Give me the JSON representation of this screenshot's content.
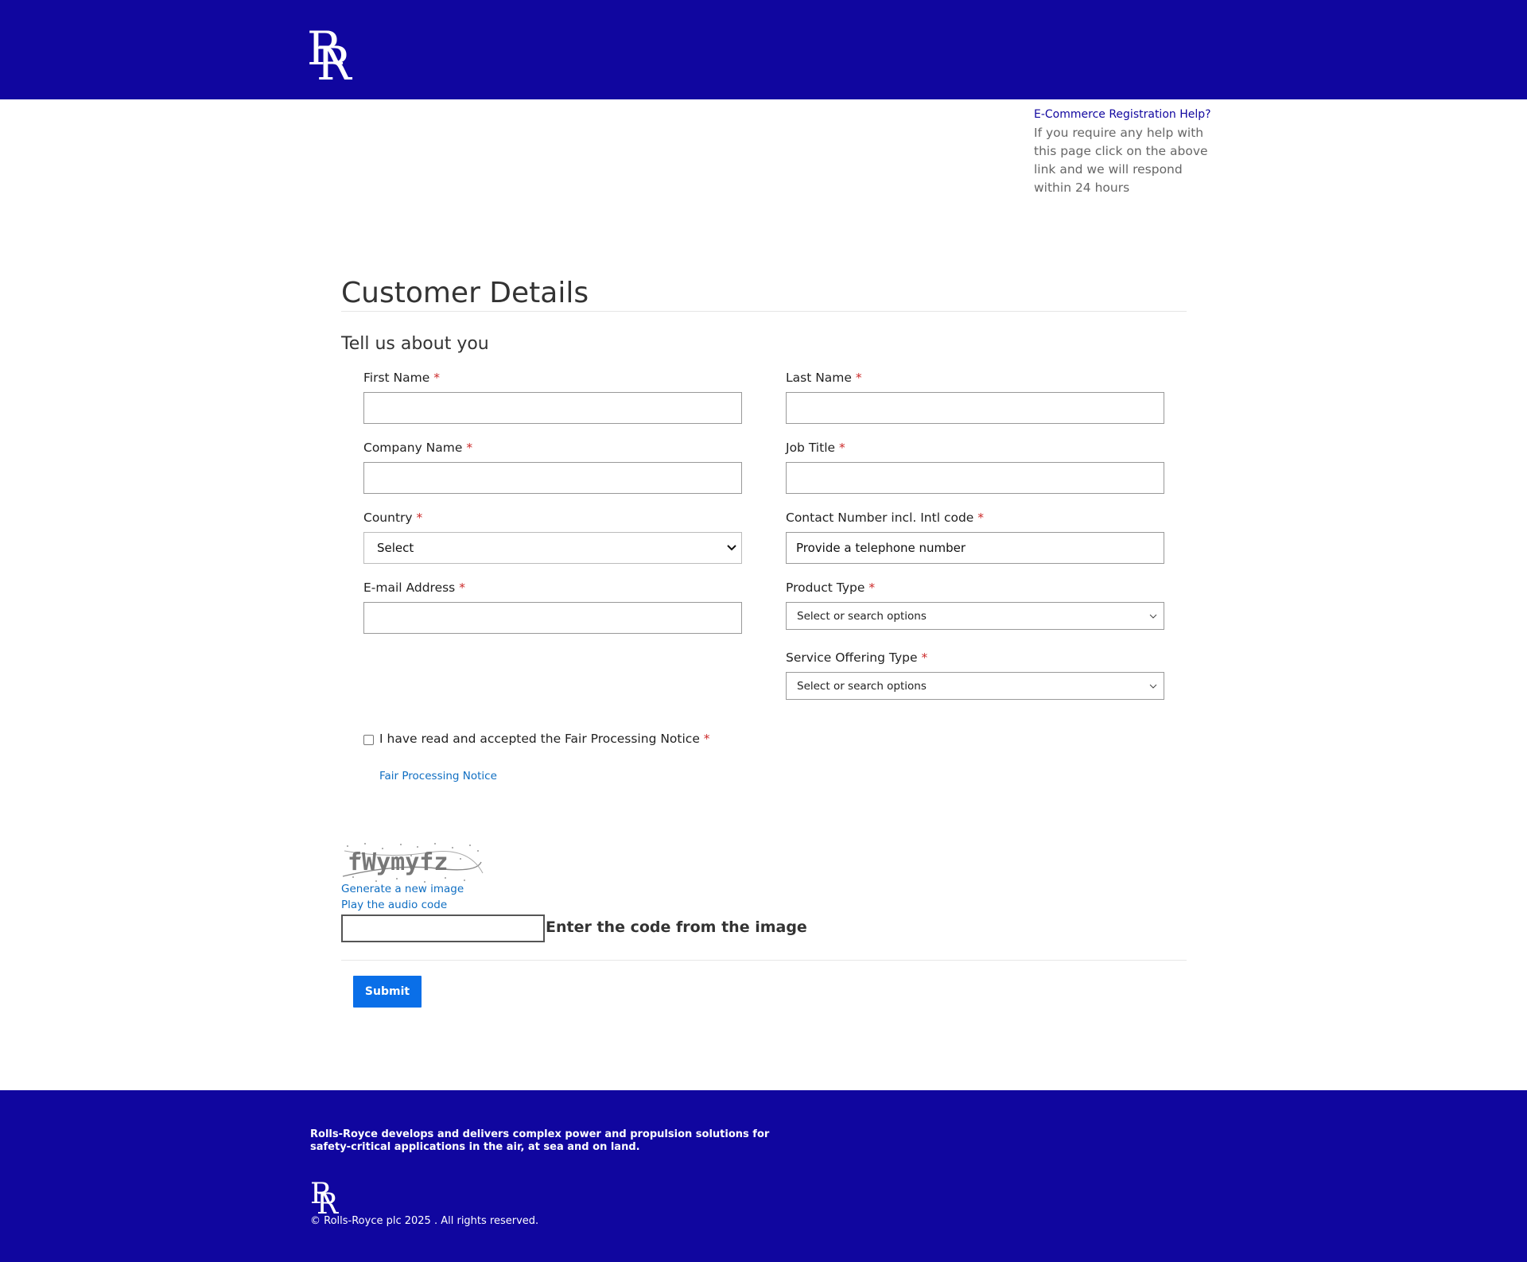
{
  "header": {
    "logo": "rolls-royce-rr-monogram"
  },
  "help": {
    "link": "E-Commerce Registration Help?",
    "text": "If you require any help with this page click on the above link and we will respond within 24 hours"
  },
  "form": {
    "title": "Customer Details",
    "subtitle": "Tell us about you",
    "required_mark": "*",
    "fields": {
      "first_name": {
        "label": "First Name",
        "value": ""
      },
      "last_name": {
        "label": "Last Name",
        "value": ""
      },
      "company_name": {
        "label": "Company Name",
        "value": ""
      },
      "job_title": {
        "label": "Job Title",
        "value": ""
      },
      "country": {
        "label": "Country",
        "selected": "Select"
      },
      "contact_number": {
        "label": "Contact Number incl. Intl code",
        "value": "Provide a telephone number"
      },
      "email": {
        "label": "E-mail Address",
        "value": ""
      },
      "product_type": {
        "label": "Product Type",
        "placeholder": "Select or search options"
      },
      "service_offering_type": {
        "label": "Service Offering Type",
        "placeholder": "Select or search options"
      }
    },
    "consent": {
      "label": "I have read and accepted the Fair Processing Notice",
      "checked": false,
      "link": "Fair Processing Notice"
    },
    "captcha": {
      "image_text": "fWymyfz",
      "new_image": "Generate a new image",
      "audio": "Play the audio code",
      "label": "Enter the code from the image"
    },
    "submit_label": "Submit"
  },
  "footer": {
    "tagline": "Rolls-Royce develops and delivers complex power and propulsion solutions for safety-critical applications in the air, at sea and on land.",
    "copyright": "© Rolls-Royce plc 2025 . All rights reserved."
  },
  "colors": {
    "brand_blue": "#10069f",
    "button_blue": "#0a6fe8",
    "link_blue": "#0f6ec2",
    "required_red": "#cc2a2a"
  }
}
